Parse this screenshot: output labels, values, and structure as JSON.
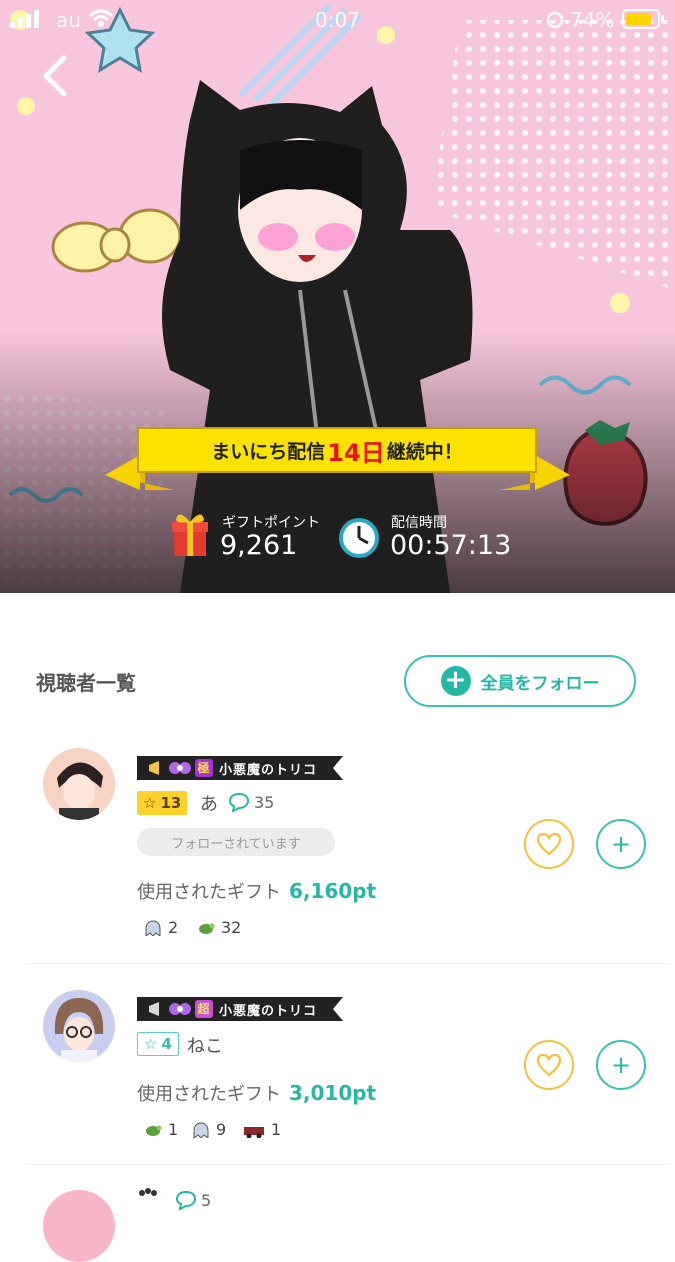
{
  "status_bar": {
    "carrier": "au",
    "time": "0:07",
    "battery": "74%"
  },
  "streak_banner": {
    "prefix": "まいにち配信",
    "days": "14日",
    "suffix": "継続中！"
  },
  "stats": {
    "gift_points_label": "ギフトポイント",
    "gift_points_value": "9,261",
    "stream_time_label": "配信時間",
    "stream_time_value": "00:57:13"
  },
  "viewers": {
    "title": "視聴者一覧",
    "follow_all_label": "全員をフォロー",
    "items": [
      {
        "title_kanji": "極",
        "title_text": "小悪魔のトリコ",
        "level": "13",
        "name": "あ",
        "comments": "35",
        "followed_status": "フォローされています",
        "gift_label": "使用されたギフト",
        "gift_points": "6,160pt",
        "gifts": [
          {
            "icon": "ghost-gift-icon",
            "count": "2"
          },
          {
            "icon": "turtle-gift-icon",
            "count": "32"
          }
        ]
      },
      {
        "title_kanji": "超",
        "title_text": "小悪魔のトリコ",
        "level": "4",
        "name": "ねこ",
        "gift_label": "使用されたギフト",
        "gift_points": "3,010pt",
        "gifts": [
          {
            "icon": "turtle-gift-icon",
            "count": "1"
          },
          {
            "icon": "ghost-gift-icon",
            "count": "9"
          },
          {
            "icon": "car-gift-icon",
            "count": "1"
          }
        ]
      },
      {
        "comments": "5"
      }
    ]
  },
  "colors": {
    "accent": "#25b8a7",
    "heart": "#f3c23c",
    "hero_bg": "#f8c6dc",
    "streak_red": "#e8141b",
    "banner_yellow": "#fbe200"
  }
}
